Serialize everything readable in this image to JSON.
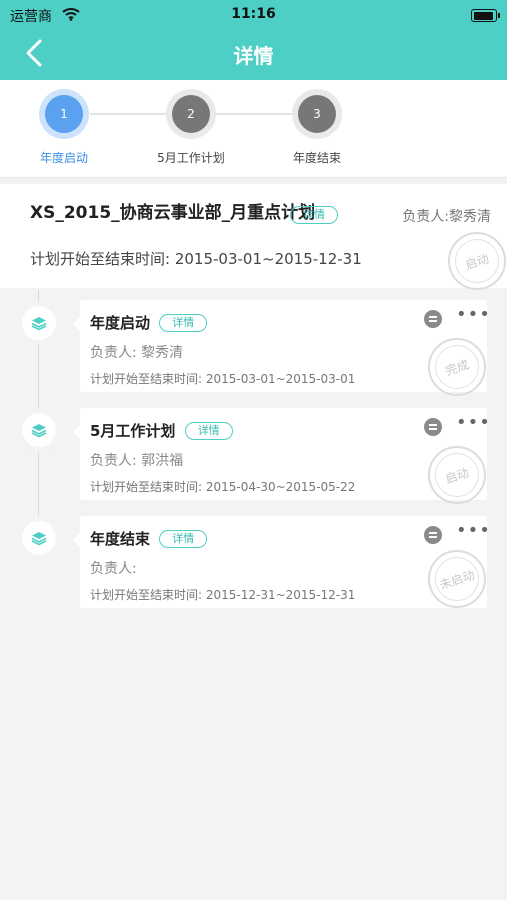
{
  "status_bar": {
    "carrier": "运营商",
    "time": "11:16"
  },
  "header": {
    "title": "详情"
  },
  "steps": [
    {
      "num": "1",
      "label": "年度启动",
      "active": true
    },
    {
      "num": "2",
      "label": "5月工作计划",
      "active": false
    },
    {
      "num": "3",
      "label": "年度结束",
      "active": false
    }
  ],
  "plan": {
    "title": "XS_2015_协商云事业部_月重点计划",
    "badge": "详情",
    "owner": "负责人:黎秀清",
    "date": "计划开始至结束时间: 2015-03-01~2015-12-31",
    "stamp": "启动"
  },
  "tasks": [
    {
      "title": "年度启动",
      "badge": "详情",
      "owner": "负责人:  黎秀清",
      "date": "计划开始至结束时间: 2015-03-01~2015-03-01",
      "stamp": "完成"
    },
    {
      "title": "5月工作计划",
      "badge": "详情",
      "owner": "负责人:  郭洪福",
      "date": "计划开始至结束时间: 2015-04-30~2015-05-22",
      "stamp": "启动"
    },
    {
      "title": "年度结束",
      "badge": "详情",
      "owner": "负责人:",
      "date": "计划开始至结束时间: 2015-12-31~2015-12-31",
      "stamp": "未启动"
    }
  ],
  "more_label": "•••"
}
